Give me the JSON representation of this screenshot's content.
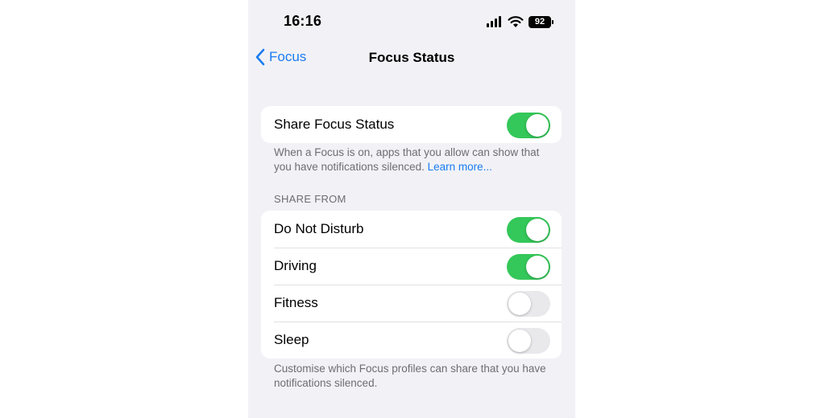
{
  "status_bar": {
    "time": "16:16",
    "battery": "92"
  },
  "nav": {
    "back_label": "Focus",
    "title": "Focus Status"
  },
  "share_group": {
    "label": "Share Focus Status",
    "on": true,
    "footnote": "When a Focus is on, apps that you allow can show that you have notifications silenced.",
    "learn_more": "Learn more..."
  },
  "share_from": {
    "header": "SHARE FROM",
    "items": [
      {
        "label": "Do Not Disturb",
        "on": true
      },
      {
        "label": "Driving",
        "on": true
      },
      {
        "label": "Fitness",
        "on": false
      },
      {
        "label": "Sleep",
        "on": false
      }
    ],
    "footnote": "Customise which Focus profiles can share that you have notifications silenced."
  },
  "colors": {
    "accent": "#1a7cf0",
    "toggle_on": "#34c759",
    "toggle_off": "#e9e9ec",
    "background": "#f2f2f6"
  }
}
